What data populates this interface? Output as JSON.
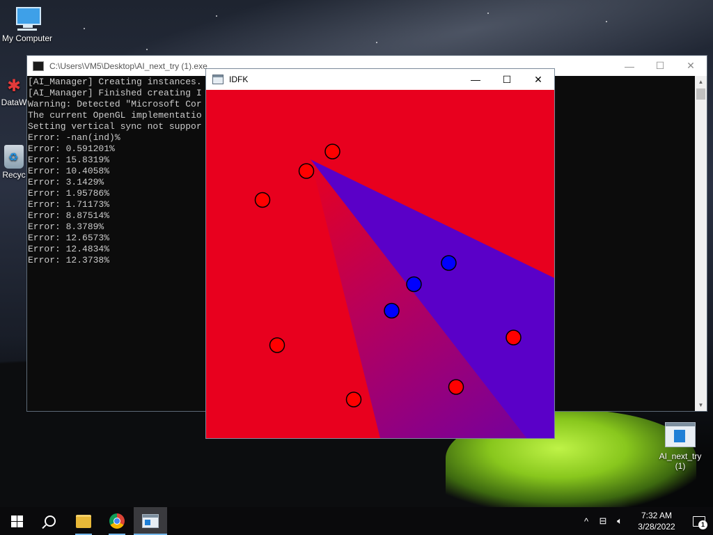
{
  "desktop": {
    "icons": [
      {
        "label": "My Computer",
        "icon": "computer-icon"
      },
      {
        "label": "DataW",
        "icon": "datawave-icon"
      },
      {
        "label": "Recyc",
        "icon": "recycle-bin-icon"
      },
      {
        "label": "AI_next_try (1)",
        "icon": "executable-icon"
      }
    ]
  },
  "console": {
    "title": "C:\\Users\\VM5\\Desktop\\AI_next_try (1).exe",
    "lines": [
      "[AI_Manager] Creating instances.",
      "[AI_Manager] Finished creating I",
      "Warning: Detected \"Microsoft Cor",
      "The current OpenGL implementatio",
      "Setting vertical sync not suppor",
      "Error: -nan(ind)%",
      "Error: 0.591201%",
      "Error: 15.8319%",
      "Error: 10.4058%",
      "Error: 3.1429%",
      "Error: 1.95786%",
      "Error: 1.71173%",
      "Error: 8.87514%",
      "Error: 8.3789%",
      "Error: 12.6573%",
      "Error: 12.4834%",
      "Error: 12.3738%"
    ],
    "buttons": {
      "minimize": "—",
      "maximize": "☐",
      "close": "✕"
    }
  },
  "idfk": {
    "title": "IDFK",
    "buttons": {
      "minimize": "—",
      "maximize": "☐",
      "close": "✕"
    },
    "colors": {
      "red": "#e8001e",
      "blue": "#5a00c8",
      "point_red": "#ff0000",
      "point_blue": "#0000ff"
    },
    "points": [
      {
        "class": "red",
        "x": 0.363,
        "y": 0.177
      },
      {
        "class": "red",
        "x": 0.288,
        "y": 0.233
      },
      {
        "class": "red",
        "x": 0.162,
        "y": 0.316
      },
      {
        "class": "blue",
        "x": 0.697,
        "y": 0.497
      },
      {
        "class": "blue",
        "x": 0.597,
        "y": 0.558
      },
      {
        "class": "blue",
        "x": 0.533,
        "y": 0.634
      },
      {
        "class": "red",
        "x": 0.883,
        "y": 0.711
      },
      {
        "class": "red",
        "x": 0.204,
        "y": 0.733
      },
      {
        "class": "red",
        "x": 0.718,
        "y": 0.853
      },
      {
        "class": "red",
        "x": 0.424,
        "y": 0.889
      }
    ]
  },
  "taskbar": {
    "items": [
      {
        "name": "start-button",
        "icon": "windows-logo-icon"
      },
      {
        "name": "search-button",
        "icon": "search-icon"
      },
      {
        "name": "file-explorer-button",
        "icon": "folder-icon"
      },
      {
        "name": "chrome-button",
        "icon": "chrome-icon"
      },
      {
        "name": "ai-next-try-taskbar-button",
        "icon": "app-window-icon"
      }
    ],
    "tray": {
      "chevron": "^",
      "time": "7:32 AM",
      "date": "3/28/2022",
      "notifications": "1"
    }
  }
}
